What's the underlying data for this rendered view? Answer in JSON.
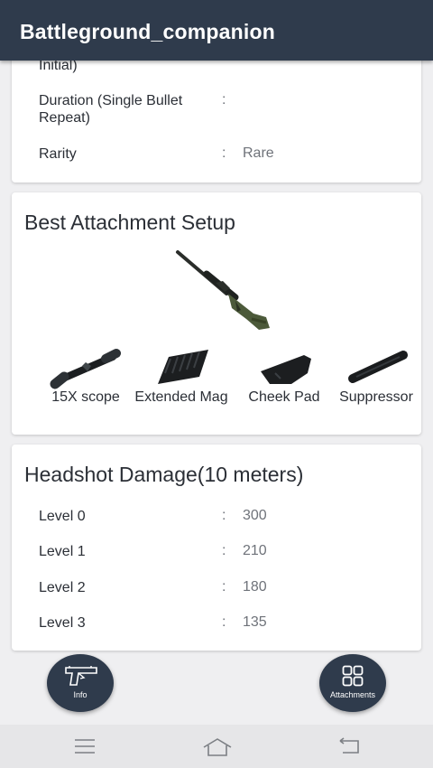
{
  "app": {
    "title": "Battleground_companion"
  },
  "stats": [
    {
      "label": "Initial)",
      "sep": "",
      "value": ""
    },
    {
      "label": "Duration (Single Bullet Repeat)",
      "sep": ":",
      "value": ""
    },
    {
      "label": "Rarity",
      "sep": ":",
      "value": "Rare"
    }
  ],
  "attachments_card": {
    "title": "Best Attachment Setup",
    "weapon_icon": "sniper-rifle",
    "items": [
      {
        "label": "15X scope",
        "icon": "scope"
      },
      {
        "label": "Extended Mag",
        "icon": "magazine"
      },
      {
        "label": "Cheek Pad",
        "icon": "cheek-pad"
      },
      {
        "label": "Suppressor",
        "icon": "suppressor"
      }
    ]
  },
  "headshot_card": {
    "title": "Headshot Damage(10 meters)",
    "rows": [
      {
        "label": "Level 0",
        "sep": ":",
        "value": "300"
      },
      {
        "label": "Level 1",
        "sep": ":",
        "value": "210"
      },
      {
        "label": "Level 2",
        "sep": ":",
        "value": "180"
      },
      {
        "label": "Level 3",
        "sep": ":",
        "value": "135"
      }
    ]
  },
  "fabs": {
    "info": {
      "label": "Info",
      "icon": "pistol-icon"
    },
    "attachments": {
      "label": "Attachments",
      "icon": "grid-icon"
    }
  },
  "colors": {
    "appbar": "#2f3b4c",
    "background": "#efeff1",
    "value_text": "#6f737a"
  }
}
